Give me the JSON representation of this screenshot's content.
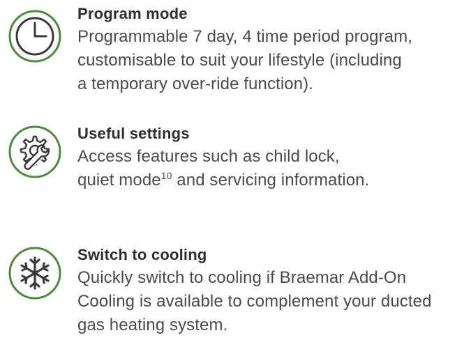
{
  "accent_color": "#4a8c3a",
  "features": [
    {
      "icon": "clock-icon",
      "title": "Program mode",
      "lines": [
        "Programmable 7 day, 4 time period program,",
        "customisable to suit your lifestyle (including",
        "a temporary over-ride function)."
      ]
    },
    {
      "icon": "gear-wrench-icon",
      "title": "Useful settings",
      "lines": [
        "Access features such as child lock,",
        "quiet mode",
        "10",
        " and servicing information."
      ]
    },
    {
      "icon": "snowflake-icon",
      "title": "Switch to cooling",
      "lines": [
        "Quickly switch to cooling if Braemar Add-On",
        "Cooling is available to complement your ducted",
        "gas heating system."
      ]
    }
  ]
}
